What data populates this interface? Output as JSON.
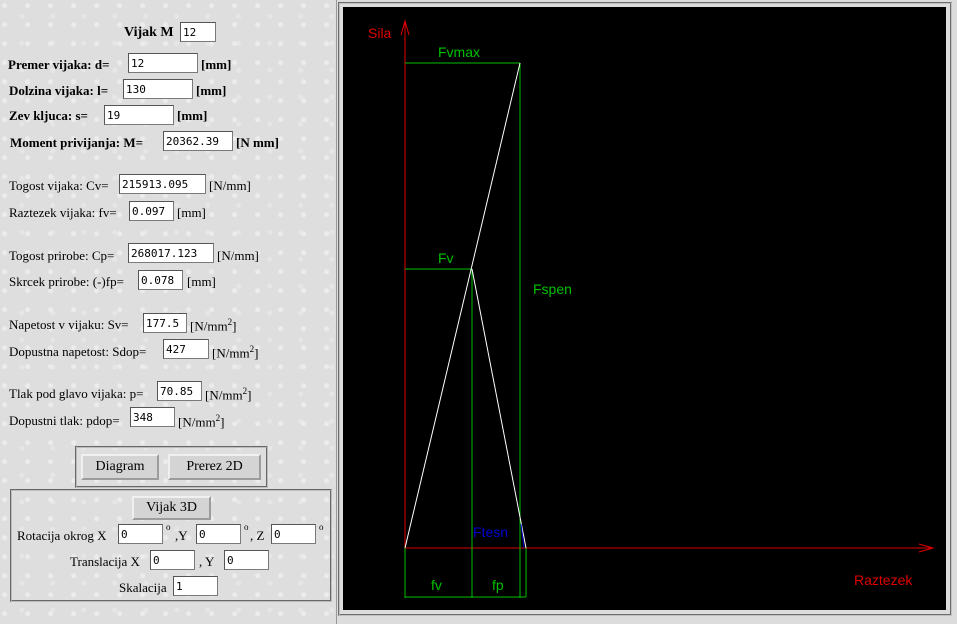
{
  "form": {
    "vijak_label": "Vijak M",
    "vijak_value": "12",
    "premer_label": "Premer vijaka: d=",
    "premer_value": "12",
    "premer_unit": "[mm]",
    "dolzina_label": "Dolzina vijaka: l=",
    "dolzina_value": "130",
    "dolzina_unit": "[mm]",
    "zev_label": "Zev kljuca: s=",
    "zev_value": "19",
    "zev_unit": "[mm]",
    "moment_label": "Moment privijanja: M=",
    "moment_value": "20362.39",
    "moment_unit": "[N mm]",
    "togost_vijaka_label": "Togost vijaka: Cv=",
    "togost_vijaka_value": "215913.095",
    "togost_vijaka_unit": "[N/mm]",
    "raztezek_label": "Raztezek vijaka: fv=",
    "raztezek_value": "0.097",
    "raztezek_unit": "[mm]",
    "togost_prirobe_label": "Togost prirobe: Cp=",
    "togost_prirobe_value": "268017.123",
    "togost_prirobe_unit": "[N/mm]",
    "skrcek_label": "Skrcek prirobe: (-)fp=",
    "skrcek_value": "0.078",
    "skrcek_unit": "[mm]",
    "napetost_label": "Napetost v vijaku: Sv=",
    "napetost_value": "177.5",
    "napetost_unit_a": "[N/mm",
    "napetost_unit_sup": "2",
    "napetost_unit_b": "]",
    "dop_napetost_label": "Dopustna napetost: Sdop=",
    "dop_napetost_value": "427",
    "dop_napetost_unit_a": "[N/mm",
    "dop_napetost_unit_sup": "2",
    "dop_napetost_unit_b": "]",
    "tlak_label": "Tlak pod glavo vijaka: p=",
    "tlak_value": "70.85",
    "tlak_unit_a": "[N/mm",
    "tlak_unit_sup": "2",
    "tlak_unit_b": "]",
    "dop_tlak_label": "Dopustni tlak: pdop=",
    "dop_tlak_value": "348",
    "dop_tlak_unit_a": "[N/mm",
    "dop_tlak_unit_sup": "2",
    "dop_tlak_unit_b": "]"
  },
  "buttons": {
    "diagram": "Diagram",
    "prerez": "Prerez 2D",
    "vijak3d": "Vijak 3D"
  },
  "panel3d": {
    "rotacija_label": "Rotacija okrog X",
    "deg": "o",
    "y_label": ",Y",
    "z_label": ", Z",
    "rot_x": "0",
    "rot_y": "0",
    "rot_z": "0",
    "translacija_label": "Translacija X",
    "trans_y_label": ", Y",
    "trans_x": "0",
    "trans_y": "0",
    "skalacija_label": "Skalacija",
    "skalacija": "1"
  },
  "diagram": {
    "y_axis": "Sila",
    "x_axis": "Raztezek",
    "fvmax": "Fvmax",
    "fv": "Fv",
    "fspen": "Fspen",
    "ftesn": "Ftesn",
    "fv_seg": "fv",
    "fp_seg": "fp",
    "colors": {
      "axis": "#e00000",
      "green": "#00c000",
      "white": "#ffffff",
      "blue": "#0000d0"
    },
    "values": {
      "fv_mm": 0.097,
      "fp_mm": 0.078
    }
  }
}
